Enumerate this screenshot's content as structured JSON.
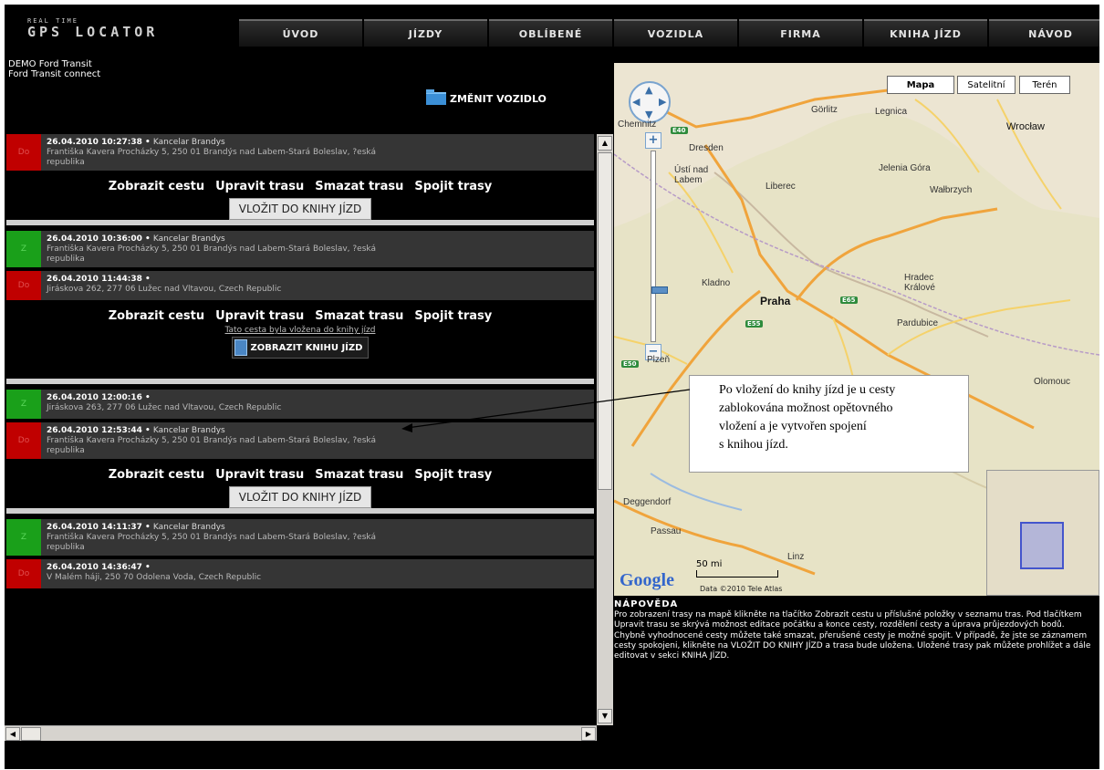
{
  "logo": {
    "line1": "REAL TIME",
    "line2": "GPS LOCATOR"
  },
  "nav": [
    "ÚVOD",
    "JÍZDY",
    "OBLÍBENÉ",
    "VOZIDLA",
    "FIRMA",
    "KNIHA JÍZD",
    "NÁVOD"
  ],
  "vehicle": {
    "line1": "DEMO Ford Transit",
    "line2": "Ford Transit connect",
    "change_label": "ZMĚNIT VOZIDLO"
  },
  "actions": {
    "show": "Zobrazit cestu",
    "edit": "Upravit trasu",
    "delete": "Smazat trasu",
    "join": "Spojit trasy",
    "insert": "VLOŽIT DO KNIHY JÍZD",
    "note": "Tato cesta byla vložena do knihy jízd",
    "show_book": "ZOBRAZIT KNIHU JÍZD"
  },
  "trips": [
    {
      "tag": "Do",
      "time": "26.04.2010 10:27:38 •",
      "place": "Kancelar Brandys",
      "addr1": "Františka Kavera Procházky 5, 250 01 Brandýs nad Labem-Stará Boleslav, ?eská",
      "addr2": "republika"
    },
    {
      "tag": "Z",
      "time": "26.04.2010 10:36:00 •",
      "place": "Kancelar Brandys",
      "addr1": "Františka Kavera Procházky 5, 250 01 Brandýs nad Labem-Stará Boleslav, ?eská",
      "addr2": "republika"
    },
    {
      "tag": "Do",
      "time": "26.04.2010 11:44:38 •",
      "place": "",
      "addr1": "Jiráskova 262, 277 06 Lužec nad Vltavou, Czech Republic",
      "addr2": ""
    },
    {
      "tag": "Z",
      "time": "26.04.2010 12:00:16 •",
      "place": "",
      "addr1": "Jiráskova 263, 277 06 Lužec nad Vltavou, Czech Republic",
      "addr2": ""
    },
    {
      "tag": "Do",
      "time": "26.04.2010 12:53:44 •",
      "place": "Kancelar Brandys",
      "addr1": "Františka Kavera Procházky 5, 250 01 Brandýs nad Labem-Stará Boleslav, ?eská",
      "addr2": "republika"
    },
    {
      "tag": "Z",
      "time": "26.04.2010 14:11:37 •",
      "place": "Kancelar Brandys",
      "addr1": "Františka Kavera Procházky 5, 250 01 Brandýs nad Labem-Stará Boleslav, ?eská",
      "addr2": "republika"
    },
    {
      "tag": "Do",
      "time": "26.04.2010 14:36:47 •",
      "place": "",
      "addr1": "V Malém háji, 250 70 Odolena Voda, Czech Republic",
      "addr2": ""
    }
  ],
  "map": {
    "type_buttons": [
      "Mapa",
      "Satelitní",
      "Terén"
    ],
    "cities": {
      "dresden": "Dresden",
      "legnica": "Legnica",
      "wroclaw": "Wrocław",
      "gorlitz": "Görlitz",
      "jelenia": "Jelenia Góra",
      "walbrzych": "Wałbrzych",
      "usti": "Ústí nad Labem",
      "liberec": "Liberec",
      "kladno": "Kladno",
      "praha": "Praha",
      "hradec": "Hradec Králové",
      "pardubice": "Pardubice",
      "plzen": "Plzeň",
      "olomouc": "Olomouc",
      "passau": "Passau",
      "linz": "Linz",
      "deggendorf": "Deggendorf",
      "chemnitz": "Chemnitz"
    },
    "highways": [
      "E40",
      "E55",
      "E50",
      "E65"
    ],
    "scale": "50 mi",
    "attribution": "Data ©2010 Tele Atlas",
    "google": "Google"
  },
  "callout": {
    "text1": "Po vložení do knihy jízd je u cesty",
    "text2": "zablokována možnost opětovného",
    "text3": "vložení a je vytvořen spojení",
    "text4": "s knihou jízd."
  },
  "help": {
    "title": "NÁPOVĚDA",
    "text": "Pro zobrazení trasy na mapě klikněte na tlačítko Zobrazit cestu u příslušné položky v seznamu tras. Pod tlačítkem Upravit trasu se skrývá možnost editace počátku a konce cesty, rozdělení cesty a úprava průjezdových bodů. Chybně vyhodnocené cesty můžete také smazat, přerušené cesty je možné spojit. V případě, že jste se záznamem cesty spokojeni, klikněte na VLOŽIT DO KNIHY JÍZD a trasa bude uložena. Uložené trasy pak můžete prohlížet a dále editovat v sekci KNIHA JÍZD."
  },
  "colors": {
    "accent_red": "#c00000",
    "accent_green": "#1aa01a",
    "background": "#000000",
    "map": "#ece5d2"
  }
}
